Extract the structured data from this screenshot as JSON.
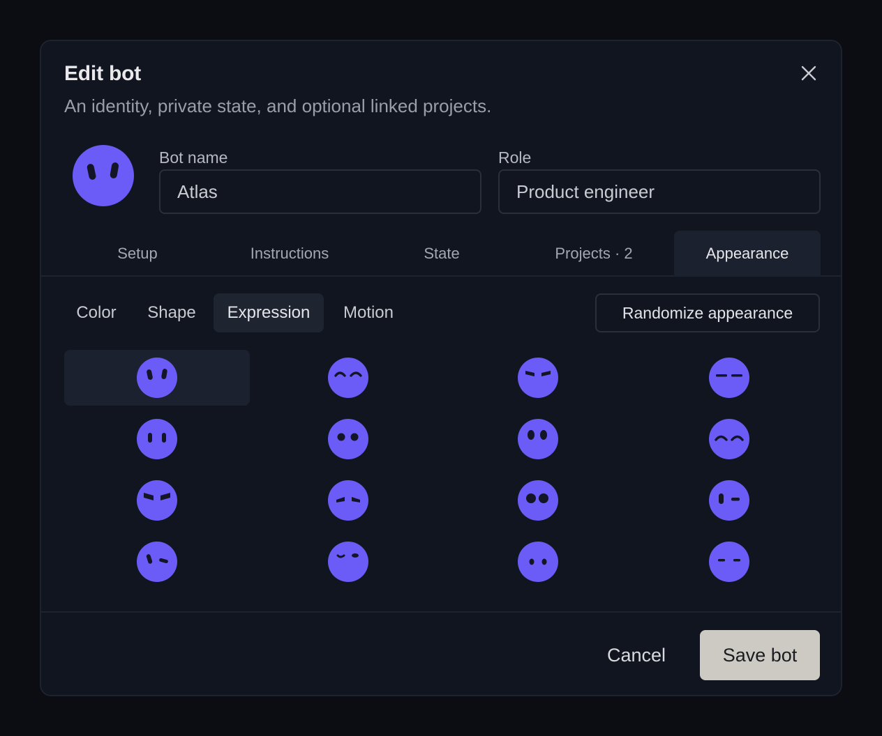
{
  "dialog": {
    "title": "Edit bot",
    "subtitle": "An identity, private state, and optional linked projects."
  },
  "avatar": {
    "icon": "smile-face-icon",
    "color": "#6c5cf7"
  },
  "fields": {
    "name_label": "Bot name",
    "name_value": "Atlas",
    "role_label": "Role",
    "role_value": "Product engineer"
  },
  "tabs": [
    {
      "label": "Setup",
      "active": false
    },
    {
      "label": "Instructions",
      "active": false
    },
    {
      "label": "State",
      "active": false
    },
    {
      "label": "Projects · 2",
      "active": false
    },
    {
      "label": "Appearance",
      "active": true
    }
  ],
  "subtabs": [
    {
      "label": "Color",
      "active": false
    },
    {
      "label": "Shape",
      "active": false
    },
    {
      "label": "Expression",
      "active": true
    },
    {
      "label": "Motion",
      "active": false
    }
  ],
  "randomize_label": "Randomize appearance",
  "expressions": {
    "selected_index": 0,
    "items": [
      "tilted-eyes-face-icon",
      "happy-arcs-face-icon",
      "angry-brows-face-icon",
      "flat-lines-face-icon",
      "upright-eyes-face-icon",
      "round-eyes-face-icon",
      "oval-eyes-face-icon",
      "happy-arcs-face-icon",
      "angry-slant-face-icon",
      "worried-slant-face-icon",
      "big-round-eyes-face-icon",
      "wink-face-icon",
      "sly-wink-face-icon",
      "sleepy-face-icon",
      "small-dots-face-icon",
      "short-dashes-face-icon"
    ]
  },
  "footer": {
    "cancel_label": "Cancel",
    "save_label": "Save bot"
  },
  "colors": {
    "accent": "#6c5cf7",
    "save_button": "#cdcac4"
  }
}
